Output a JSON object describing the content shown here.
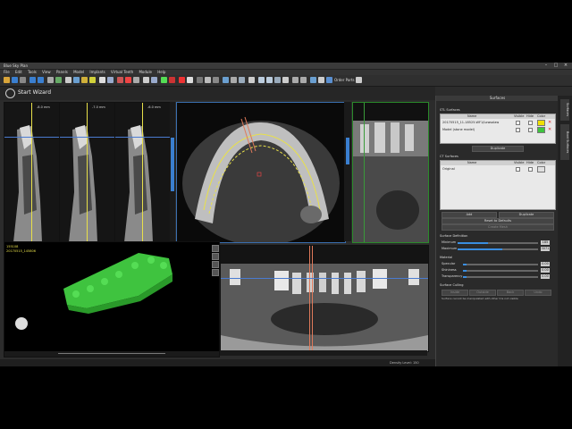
{
  "app": {
    "title": "Blue Sky Plan",
    "menu": [
      "File",
      "Edit",
      "Tools",
      "View",
      "Panels",
      "Model",
      "Implants",
      "Virtual Teeth",
      "Module",
      "Help"
    ],
    "order_parts": "Order Parts",
    "wizard_label": "Start Wizard"
  },
  "views": {
    "cross_labels": [
      "-8.0 mm",
      "-7.0 mm",
      "-6.0 mm"
    ],
    "ruler_marks": [
      "1",
      "2",
      "3",
      "4"
    ],
    "left_info_line1": "155108",
    "left_info_line2": "20170515_145806",
    "density_level": "Density Level: 150"
  },
  "surfaces_panel": {
    "title": "Surfaces",
    "stl_section": "STL Surfaces",
    "stl_columns": [
      "Name",
      "Visible",
      "Hide",
      "Color"
    ],
    "stl_rows": [
      {
        "name": "20170515_11-18525-WF1/Lowsolaw",
        "color": "#f0e000"
      },
      {
        "name": "Model (stone model)",
        "color": "#3ec43e"
      }
    ],
    "stl_button": "Duplicate",
    "ct_section": "CT Surfaces",
    "ct_columns": [
      "Name",
      "Visible",
      "Hide",
      "Color"
    ],
    "ct_rows": [
      {
        "name": "Original",
        "color": "#e0e0e0"
      }
    ],
    "add_button": "Add",
    "duplicate_button": "Duplicate",
    "reset_button": "Reset to Defaults",
    "create_mesh_button": "Create Mesh",
    "surface_def_section": "Surface Definition",
    "minimum_label": "Minimum",
    "maximum_label": "Maximum",
    "minimum_value": "185",
    "maximum_value": "3071",
    "material_section": "Material",
    "specular_label": "Specular",
    "shininess_label": "Shininess",
    "transparency_label": "Transparency",
    "specular_value": "0.00",
    "shininess_value": "0.00",
    "transparency_value": "0.00",
    "min_level": 0.38,
    "max_level": 0.56,
    "specular_level": 0.05,
    "shininess_level": 0.05,
    "transparency_level": 0.05,
    "culling_section": "Surface Culling",
    "culling_buttons": [
      "Inside",
      "Outside",
      "Back",
      "Undo"
    ],
    "culling_note": "Surface cannot be manipulated with other tris not visible"
  },
  "side_tabs": [
    "Surfaces",
    "Boot Surfaces"
  ]
}
